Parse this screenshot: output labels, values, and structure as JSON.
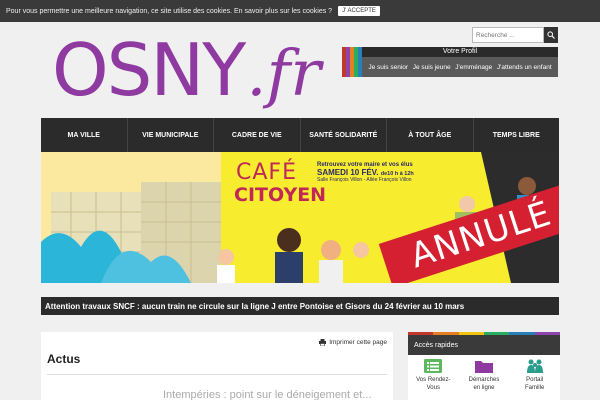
{
  "cookie": {
    "text": "Pour vous permettre une meilleure navigation, ce site utilise des cookies. En savoir plus sur les cookies ?",
    "accept": "J' ACCEPTE"
  },
  "logo": {
    "main": "OSNY",
    "suffix": ".fr",
    "color": "#8e3aa1"
  },
  "search": {
    "placeholder": "Recherche ...",
    "icon": "search-icon"
  },
  "profil": {
    "title": "Votre Profil",
    "links": [
      "Je suis senior",
      "Je suis jeune",
      "J'emménage",
      "J'attends un enfant"
    ],
    "stripe_colors": [
      "#c0392b",
      "#8e44ad",
      "#e67e22",
      "#27ae60",
      "#2980b9"
    ]
  },
  "nav": [
    "MA VILLE",
    "VIE MUNICIPALE",
    "CADRE DE VIE",
    "SANTÉ SOLIDARITÉ",
    "À TOUT ÂGE",
    "TEMPS LIBRE"
  ],
  "banner": {
    "line1": "CAFÉ",
    "line2": "CITOYEN",
    "info1": "Retrouvez votre maire et vos élus",
    "info2": "SAMEDI 10 FÉV.",
    "info2b": "de10 h à 12h",
    "info3": "Salle François Villon - Allée François Villon",
    "stamp": "ANNULÉ",
    "bg_color": "#f7ec2d",
    "accent_color": "#c02858",
    "stamp_color": "#d42030"
  },
  "alert": "Attention travaux SNCF : aucun train ne circule sur la ligne J entre Pontoise et Gisors du 24 février au 10 mars",
  "main": {
    "print": "Imprimer cette page",
    "title": "Actus",
    "news_title": "Intempéries : point sur le déneigement et..."
  },
  "side": {
    "title": "Accès rapides",
    "items": [
      {
        "label1": "Vos Rendez-",
        "label2": "Vous",
        "icon": "list-icon",
        "color": "#5cb85c"
      },
      {
        "label1": "Démarches",
        "label2": "en ligne",
        "icon": "folder-icon",
        "color": "#8e3aa1"
      },
      {
        "label1": "Portail",
        "label2": "Famille",
        "icon": "family-icon",
        "color": "#2a9d8f"
      }
    ]
  }
}
